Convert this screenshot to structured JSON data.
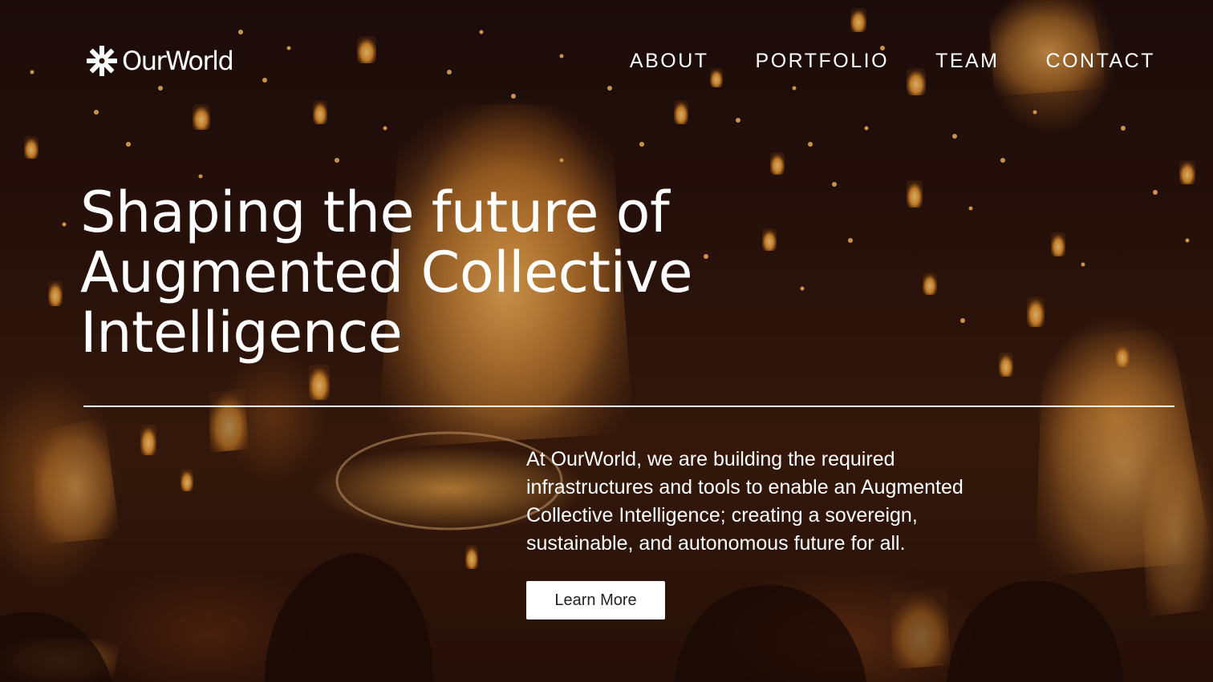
{
  "brand": {
    "name": "OurWorld",
    "logo_icon": "snowflake-mark-icon"
  },
  "nav": {
    "items": [
      {
        "label": "ABOUT"
      },
      {
        "label": "PORTFOLIO"
      },
      {
        "label": "TEAM"
      },
      {
        "label": "CONTACT"
      }
    ]
  },
  "hero": {
    "headline_lines": [
      "Shaping the future of",
      "Augmented Collective",
      "Intelligence"
    ],
    "lead": "At OurWorld, we are building the required infrastructures and tools to enable an Augmented Collective Intelligence; creating a sovereign, sustainable, and autonomous future for all.",
    "cta_label": "Learn More",
    "background": "night-sky-floating-lanterns-photo"
  },
  "colors": {
    "text": "#ffffff",
    "button_bg": "#ffffff",
    "button_text": "#222222",
    "lantern_glow": "#e8962d",
    "sky": "#1d0d0b"
  }
}
